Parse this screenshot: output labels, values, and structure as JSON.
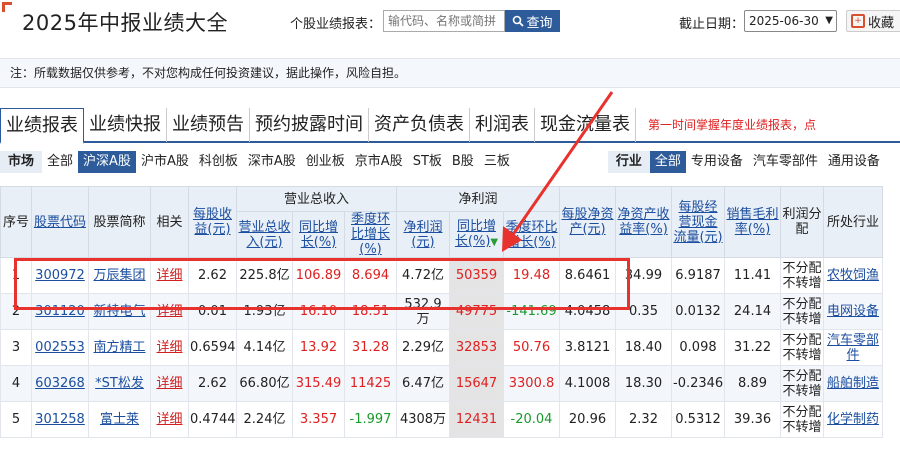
{
  "header": {
    "title": "2025年中报业绩大全",
    "report_label": "个股业绩报表：",
    "search_placeholder": "输代码、名称或简拼",
    "search_button": "查询",
    "date_label": "截止日期：",
    "date_value": "2025-06-30",
    "favorite_button": "收藏"
  },
  "notice": "注：所载数据仅供参考，不对您构成任何投资建议，据此操作，风险自担。",
  "tabs": [
    {
      "label": "业绩报表",
      "active": true
    },
    {
      "label": "业绩快报"
    },
    {
      "label": "业绩预告"
    },
    {
      "label": "预约披露时间"
    },
    {
      "label": "资产负债表"
    },
    {
      "label": "利润表"
    },
    {
      "label": "现金流量表"
    }
  ],
  "promo": "第一时间掌握年度业绩报表，点",
  "market_filter": {
    "head": "市场",
    "items": [
      "全部",
      "沪深A股",
      "沪市A股",
      "科创板",
      "深市A股",
      "创业板",
      "京市A股",
      "ST板",
      "B股",
      "三板"
    ],
    "active": "沪深A股"
  },
  "industry_filter": {
    "head": "行业",
    "items": [
      "全部",
      "专用设备",
      "汽车零部件",
      "通用设备"
    ],
    "active": "全部"
  },
  "table": {
    "headers": {
      "index": "序号",
      "code": "股票代码",
      "name": "股票简称",
      "related": "相关",
      "eps": "每股收益(元)",
      "revenue_group": "营业总收入",
      "revenue": "营业总收入(元)",
      "revenue_yoy": "同比增长(%)",
      "revenue_qoq": "季度环比增长(%)",
      "profit_group": "净利润",
      "profit": "净利润(元)",
      "profit_yoy": "同比增长(%)",
      "profit_qoq": "季度环比增长(%)",
      "bvps": "每股净资产(元)",
      "roe": "净资产收益率(%)",
      "ocfps": "每股经营现金流量(元)",
      "gross_margin": "销售毛利率(%)",
      "dividend": "利润分配",
      "industry": "所处行业"
    },
    "rows": [
      {
        "idx": "1",
        "code": "300972",
        "name": "万辰集团",
        "related": "详细",
        "eps": "2.62",
        "revenue": "225.8亿",
        "revenue_yoy": "106.89",
        "revenue_qoq": "8.694",
        "profit": "4.72亿",
        "profit_yoy": "50359",
        "profit_qoq": "19.48",
        "bvps": "8.6461",
        "roe": "34.99",
        "ocfps": "6.9187",
        "gross_margin": "11.41",
        "dividend": "不分配不转增",
        "industry": "农牧饲渔"
      },
      {
        "idx": "2",
        "code": "301120",
        "name": "新特电气",
        "related": "详细",
        "eps": "0.01",
        "revenue": "1.93亿",
        "revenue_yoy": "16.10",
        "revenue_qoq": "18.51",
        "profit": "532.9万",
        "profit_yoy": "49775",
        "profit_qoq": "-141.69",
        "bvps": "4.0458",
        "roe": "0.35",
        "ocfps": "0.0132",
        "gross_margin": "24.14",
        "dividend": "不分配不转增",
        "industry": "电网设备"
      },
      {
        "idx": "3",
        "code": "002553",
        "name": "南方精工",
        "related": "详细",
        "eps": "0.6594",
        "revenue": "4.14亿",
        "revenue_yoy": "13.92",
        "revenue_qoq": "31.28",
        "profit": "2.29亿",
        "profit_yoy": "32853",
        "profit_qoq": "50.76",
        "bvps": "3.8121",
        "roe": "18.40",
        "ocfps": "0.098",
        "gross_margin": "31.22",
        "dividend": "不分配不转增",
        "industry": "汽车零部件"
      },
      {
        "idx": "4",
        "code": "603268",
        "name": "*ST松发",
        "related": "详细",
        "eps": "2.62",
        "revenue": "66.80亿",
        "revenue_yoy": "315.49",
        "revenue_qoq": "11425",
        "profit": "6.47亿",
        "profit_yoy": "15647",
        "profit_qoq": "3300.8",
        "bvps": "4.1008",
        "roe": "18.30",
        "ocfps": "-0.2346",
        "gross_margin": "8.89",
        "dividend": "不分配不转增",
        "industry": "船舶制造"
      },
      {
        "idx": "5",
        "code": "301258",
        "name": "富士莱",
        "related": "详细",
        "eps": "0.4744",
        "revenue": "2.24亿",
        "revenue_yoy": "3.357",
        "revenue_qoq": "-1.997",
        "profit": "4308万",
        "profit_yoy": "12431",
        "profit_qoq": "-20.04",
        "bvps": "20.96",
        "roe": "2.32",
        "ocfps": "0.5312",
        "gross_margin": "39.36",
        "dividend": "不分配不转增",
        "industry": "化学制药"
      }
    ]
  },
  "colors": {
    "accent": "#2e5c9a",
    "positive": "#e02020",
    "negative": "#1a9a2a",
    "annotation": "#e8322e"
  }
}
